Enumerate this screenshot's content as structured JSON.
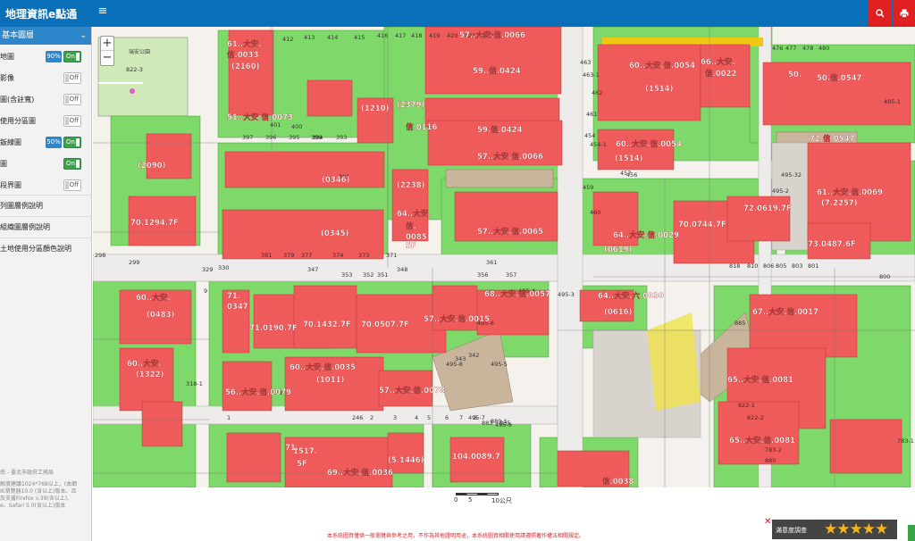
{
  "header": {
    "app_title": "地理資訊e點通",
    "menu_icon": "hamburger-icon",
    "search_icon": "search-icon",
    "print_icon": "print-icon"
  },
  "sidebar": {
    "section_title": "基本圖層",
    "layers": [
      {
        "label": "地圖",
        "percent": "90%",
        "state": "On"
      },
      {
        "label": "影像",
        "percent": "",
        "state": "Off"
      },
      {
        "label": "圖(含註寬)",
        "percent": "",
        "state": "Off"
      },
      {
        "label": "使用分區圖",
        "percent": "",
        "state": "Off"
      },
      {
        "label": "鈑線圖",
        "percent": "50%",
        "state": "On"
      },
      {
        "label": "圖",
        "percent": "",
        "state": "On"
      },
      {
        "label": "段界圖",
        "percent": "",
        "state": "Off"
      }
    ],
    "links": [
      "列圖層例說明",
      "組織圖層例說明",
      "土地使用分區顏色說明"
    ],
    "footer": [
      "南 - 臺北市政府工務局",
      "解度建議1024*768以上，(本網",
      "IE瀏覽器10.0 (含以上)版本、且",
      "及支援Firefox v.39(含以上),",
      "e、Safari 5.0(含以上)版本"
    ]
  },
  "map": {
    "zoom_in": "+",
    "zoom_out": "−",
    "labels": [
      {
        "t": "61..大安.",
        "c": "w"
      },
      {
        "t": "信.0033",
        "c": "w"
      },
      {
        "t": "(2160)",
        "c": "w"
      },
      {
        "t": "57..大安.信.0066",
        "c": "w"
      },
      {
        "t": "59..信.0424",
        "c": "w"
      },
      {
        "t": "60..大安.信.0054",
        "c": "w"
      },
      {
        "t": "66..大安.",
        "c": "w"
      },
      {
        "t": "信.0022",
        "c": "w"
      },
      {
        "t": "(1514)",
        "c": "w"
      },
      {
        "t": "50.",
        "c": "w"
      },
      {
        "t": "50.信.0547",
        "c": "w"
      },
      {
        "t": "51..大安.信.0073",
        "c": "w"
      },
      {
        "t": "(2090)",
        "c": "w"
      },
      {
        "t": "(1210)",
        "c": "w"
      },
      {
        "t": "(2379)",
        "c": "w"
      },
      {
        "t": "信.0116",
        "c": "w"
      },
      {
        "t": "59.信.0424",
        "c": "w"
      },
      {
        "t": "57..大安.信.0066",
        "c": "w"
      },
      {
        "t": "60..大安.信.0054",
        "c": "w"
      },
      {
        "t": "(1514)",
        "c": "w"
      },
      {
        "t": "72.信.0547",
        "c": "w"
      },
      {
        "t": "70.1294.7F",
        "c": "w"
      },
      {
        "t": "(0346)",
        "c": "w"
      },
      {
        "t": "(2238)",
        "c": "w"
      },
      {
        "t": "64..大安.",
        "c": "w"
      },
      {
        "t": "信.",
        "c": "w"
      },
      {
        "t": "0085",
        "c": "w"
      },
      {
        "t": "5F",
        "c": "w"
      },
      {
        "t": "57..大安.信.0065",
        "c": "w"
      },
      {
        "t": "(0345)",
        "c": "w"
      },
      {
        "t": "64..大安.信.0029",
        "c": "w"
      },
      {
        "t": "(0619)",
        "c": "w"
      },
      {
        "t": "70.0744.7F",
        "c": "w"
      },
      {
        "t": "72.0619.7F",
        "c": "w"
      },
      {
        "t": "61..大安.信.0069",
        "c": "w"
      },
      {
        "t": "(7.2257)",
        "c": "w"
      },
      {
        "t": "73.0487.6F",
        "c": "w"
      },
      {
        "t": "60..大安.",
        "c": "w"
      },
      {
        "t": "(0483)",
        "c": "w"
      },
      {
        "t": "71.",
        "c": "w"
      },
      {
        "t": "0347",
        "c": "w"
      },
      {
        "t": "71.0190.7F",
        "c": "w"
      },
      {
        "t": "70.1432.7F",
        "c": "w"
      },
      {
        "t": "70.0507.7F",
        "c": "w"
      },
      {
        "t": "57..大安.信.0015",
        "c": "w"
      },
      {
        "t": "68..大安.信.0057",
        "c": "w"
      },
      {
        "t": "64..大安.六.0030",
        "c": "w"
      },
      {
        "t": "(0616)",
        "c": "w"
      },
      {
        "t": "67..大安.信.0017",
        "c": "w"
      },
      {
        "t": "60..大安.",
        "c": "w"
      },
      {
        "t": "(1322)",
        "c": "w"
      },
      {
        "t": "60..大安.信.0035",
        "c": "w"
      },
      {
        "t": "(1011)",
        "c": "w"
      },
      {
        "t": "56..大安.信.0079",
        "c": "w"
      },
      {
        "t": "57..大安.信.0078",
        "c": "w"
      },
      {
        "t": "65..大安.信.0081",
        "c": "w"
      },
      {
        "t": "65..大安.信.0081",
        "c": "w"
      },
      {
        "t": "71.",
        "c": "w"
      },
      {
        "t": "1517.",
        "c": "w"
      },
      {
        "t": "5F",
        "c": "w"
      },
      {
        "t": "69..大安.信.0036",
        "c": "w"
      },
      {
        "t": "(5.1446)",
        "c": "w"
      },
      {
        "t": "104.0089.7",
        "c": "w"
      },
      {
        "t": "信.0038",
        "c": "w"
      }
    ],
    "parcels": [
      "412",
      "413",
      "414",
      "415",
      "416",
      "417",
      "418",
      "419",
      "420",
      "421",
      "422",
      "401",
      "400",
      "399",
      "397",
      "396",
      "395",
      "394",
      "393",
      "391",
      "381",
      "379",
      "377",
      "374",
      "373",
      "371",
      "353",
      "352",
      "351",
      "347",
      "348",
      "330",
      "329",
      "299",
      "298",
      "361",
      "357",
      "356",
      "343",
      "342",
      "318",
      "318-1",
      "495-8",
      "495-4",
      "495-6",
      "495-5",
      "495-3",
      "495-7",
      "495-9",
      "454",
      "454-1",
      "457",
      "456",
      "461",
      "462",
      "463",
      "463-1",
      "460",
      "459",
      "495-1",
      "495-2",
      "495-32",
      "476",
      "477",
      "478",
      "480",
      "818",
      "810",
      "806",
      "805",
      "803",
      "801",
      "800",
      "783-1",
      "783-2",
      "880",
      "880-1",
      "835",
      "883",
      "885",
      "822-1",
      "822-2",
      "822-3",
      "246",
      "2",
      "3",
      "4",
      "5",
      "6",
      "7",
      "8",
      "9",
      "1",
      "10"
    ],
    "park_label": "246",
    "park_name": "瑞安公園"
  },
  "scale": {
    "zero": "0",
    "five": "5",
    "ten": "10公尺"
  },
  "footer": {
    "disclaimer": "本系統圖資僅供一般瀏覽與參考之用，不作為其他證明用途，本系統圖資相關使用請遵照著作權法相關規定。",
    "survey_label": "滿意度調查",
    "stars": "★★★★★"
  },
  "colors": {
    "header": "#0a6fb9",
    "accent_red": "#e02020",
    "building_red": "#ef5a5a",
    "green_zone": "#7fd86a",
    "road_gray": "#e8e6e3",
    "tan": "#c9b59b"
  }
}
